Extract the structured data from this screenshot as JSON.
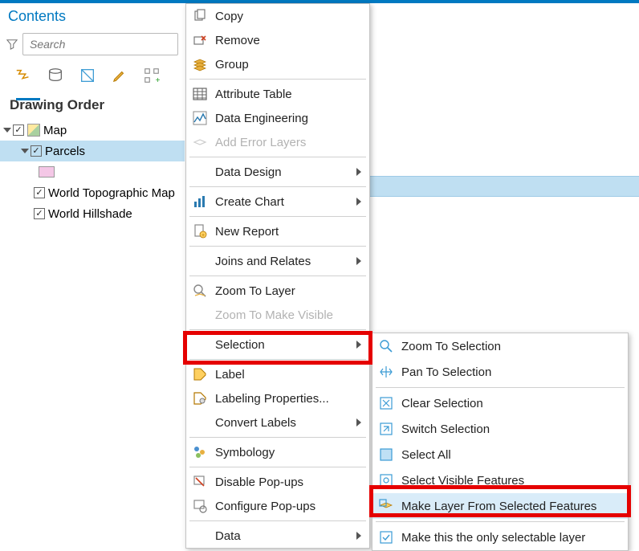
{
  "panel": {
    "title": "Contents",
    "search_placeholder": "Search",
    "heading": "Drawing Order"
  },
  "tree": {
    "map": "Map",
    "parcels": "Parcels",
    "topo": "World Topographic Map",
    "hill": "World Hillshade"
  },
  "menu": {
    "copy": "Copy",
    "remove": "Remove",
    "group": "Group",
    "attribute_table": "Attribute Table",
    "data_engineering": "Data Engineering",
    "add_error_layers": "Add Error Layers",
    "data_design": "Data Design",
    "create_chart": "Create Chart",
    "new_report": "New Report",
    "joins_relates": "Joins and Relates",
    "zoom_layer": "Zoom To Layer",
    "zoom_visible": "Zoom To Make Visible",
    "selection": "Selection",
    "label": "Label",
    "labeling_props": "Labeling Properties...",
    "convert_labels": "Convert Labels",
    "symbology": "Symbology",
    "disable_popups": "Disable Pop-ups",
    "configure_popups": "Configure Pop-ups",
    "data": "Data"
  },
  "submenu": {
    "zoom_sel": "Zoom To Selection",
    "pan_sel": "Pan To Selection",
    "clear_sel": "Clear Selection",
    "switch_sel": "Switch Selection",
    "select_all": "Select All",
    "select_visible": "Select Visible Features",
    "make_layer": "Make Layer From Selected Features",
    "only_selectable": "Make this the only selectable layer"
  }
}
